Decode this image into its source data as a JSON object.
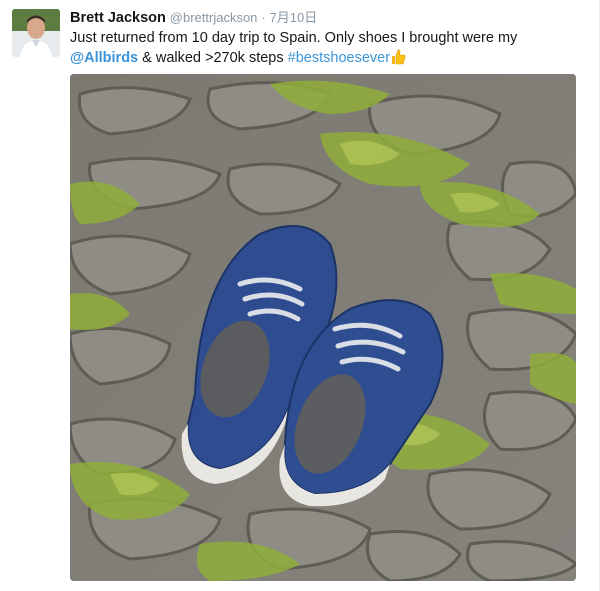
{
  "tweet": {
    "author_name": "Brett Jackson",
    "author_handle": "@brettrjackson",
    "separator": "·",
    "date": "7月10日",
    "text_part1": "Just returned from 10 day trip to Spain. Only shoes I brought were my",
    "mention": "@Allbirds",
    "text_part2": " & walked >270k steps ",
    "hashtag": "#bestshoesever",
    "emoji_icon": "thumbs-up-emoji",
    "link_color": "#3b94d9"
  }
}
